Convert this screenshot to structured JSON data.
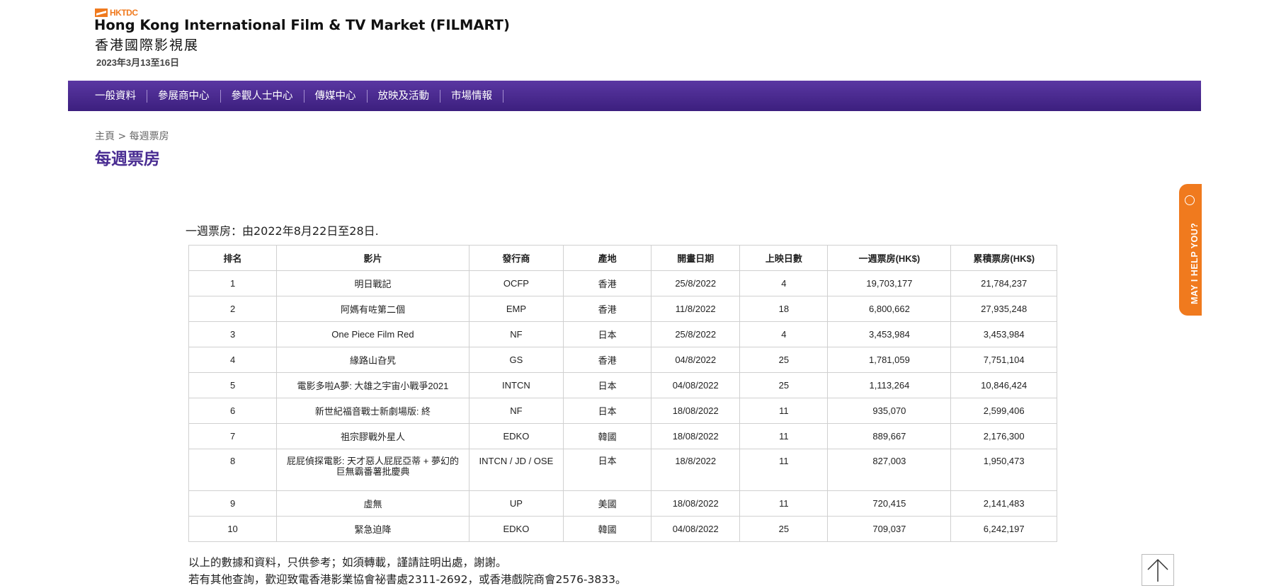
{
  "header": {
    "logo_text": "HKTDC",
    "title_en": "Hong Kong International Film & TV Market (FILMART)",
    "title_zh": "香港國際影視展",
    "dates": "2023年3月13至16日"
  },
  "nav": [
    "一般資料",
    "參展商中心",
    "參觀人士中心",
    "傳媒中心",
    "放映及活動",
    "市場情報"
  ],
  "breadcrumb": "主頁 > 每週票房",
  "page_title": "每週票房",
  "intro": "一週票房：由2022年8月22日至28日.",
  "table": {
    "headers": [
      "排名",
      "影片",
      "發行商",
      "產地",
      "開畫日期",
      "上映日數",
      "一週票房(HK$)",
      "累積票房(HK$)"
    ],
    "rows": [
      [
        "1",
        "明日戰記",
        "OCFP",
        "香港",
        "25/8/2022",
        "4",
        "19,703,177",
        "21,784,237"
      ],
      [
        "2",
        "阿媽有咗第二個",
        "EMP",
        "香港",
        "11/8/2022",
        "18",
        "6,800,662",
        "27,935,248"
      ],
      [
        "3",
        "One Piece Film Red",
        "NF",
        "日本",
        "25/8/2022",
        "4",
        "3,453,984",
        "3,453,984"
      ],
      [
        "4",
        "緣路山旮旯",
        "GS",
        "香港",
        "04/8/2022",
        "25",
        "1,781,059",
        "7,751,104"
      ],
      [
        "5",
        "電影多啦A夢: 大雄之宇宙小戰爭2021",
        "INTCN",
        "日本",
        "04/08/2022",
        "25",
        "1,113,264",
        "10,846,424"
      ],
      [
        "6",
        "新世紀福音戰士新劇場版: 終",
        "NF",
        "日本",
        "18/08/2022",
        "11",
        "935,070",
        "2,599,406"
      ],
      [
        "7",
        "祖宗膠戰外星人",
        "EDKO",
        "韓國",
        "18/08/2022",
        "11",
        "889,667",
        "2,176,300"
      ],
      [
        "8",
        "屁屁偵探電影: 天才惡人屁屁亞蒂 + 夢幻的巨無霸番薯批慶典",
        "INTCN / JD / OSE",
        "日本",
        "18/8/2022",
        "11",
        "827,003",
        "1,950,473"
      ],
      [
        "9",
        "虛無",
        "UP",
        "美國",
        "18/08/2022",
        "11",
        "720,415",
        "2,141,483"
      ],
      [
        "10",
        "緊急迫降",
        "EDKO",
        "韓國",
        "04/08/2022",
        "25",
        "709,037",
        "6,242,197"
      ]
    ]
  },
  "footer": {
    "note1": "以上的數據和資料，只供參考；如須轉載，謹請註明出處，謝謝。",
    "note2": "若有其他查詢，歡迎致電香港影業協會祕書處2311-2692，或香港戲院商會2576-3833。"
  },
  "help_tab": "MAY I HELP YOU?",
  "colors": {
    "nav_bg": "#4a2d92",
    "accent_orange": "#f07a1e",
    "title_purple": "#4a2d92"
  },
  "icons": {
    "help": "chat-bubble-icon",
    "back_to_top": "arrow-up-icon"
  }
}
